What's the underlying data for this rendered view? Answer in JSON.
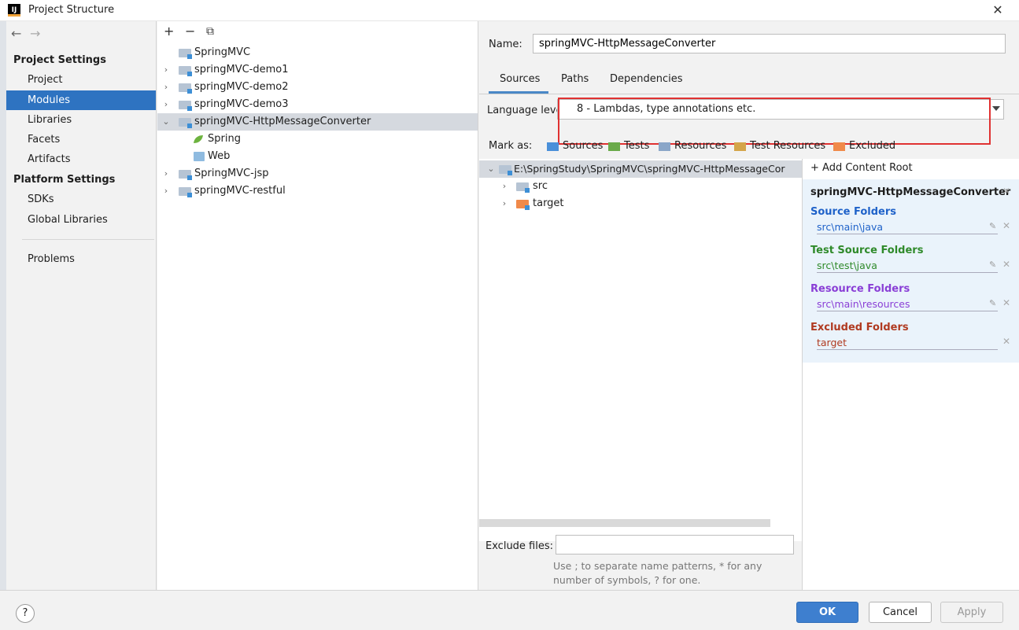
{
  "window": {
    "title": "Project Structure",
    "close": "✕"
  },
  "nav": {
    "back": "←",
    "forward": "→",
    "project_settings_header": "Project Settings",
    "project_items": [
      "Project",
      "Modules",
      "Libraries",
      "Facets",
      "Artifacts"
    ],
    "platform_settings_header": "Platform Settings",
    "platform_items": [
      "SDKs",
      "Global Libraries"
    ],
    "problems": "Problems",
    "selected": "Modules"
  },
  "module_tree": {
    "toolbar": {
      "add": "+",
      "remove": "−",
      "copy": "⧉"
    },
    "rows": [
      {
        "label": "SpringMVC",
        "chevron": ""
      },
      {
        "label": "springMVC-demo1",
        "chevron": "›"
      },
      {
        "label": "springMVC-demo2",
        "chevron": "›"
      },
      {
        "label": "springMVC-demo3",
        "chevron": "›"
      },
      {
        "label": "springMVC-HttpMessageConverter",
        "chevron": "⌄"
      },
      {
        "label": "Spring",
        "chevron": ""
      },
      {
        "label": "Web",
        "chevron": ""
      },
      {
        "label": "SpringMVC-jsp",
        "chevron": "›"
      },
      {
        "label": "springMVC-restful",
        "chevron": "›"
      }
    ]
  },
  "detail": {
    "name_label": "Name:",
    "name_value": "springMVC-HttpMessageConverter",
    "tabs": [
      "Sources",
      "Paths",
      "Dependencies"
    ],
    "active_tab": "Sources",
    "language_level_label": "Language level:",
    "language_level_value": "8 - Lambdas, type annotations etc.",
    "mark_as_label": "Mark as:",
    "mark_as": [
      {
        "label": "Sources",
        "color": "#4a90d9"
      },
      {
        "label": "Tests",
        "color": "#6aaa4a"
      },
      {
        "label": "Resources",
        "color": "#8aa6c8"
      },
      {
        "label": "Test Resources",
        "color": "#d4a54a"
      },
      {
        "label": "Excluded",
        "color": "#f08a4a"
      }
    ],
    "content_tree": [
      {
        "label": "E:\\SpringStudy\\SpringMVC\\springMVC-HttpMessageCor",
        "chevron": "⌄"
      },
      {
        "label": "src",
        "chevron": "›"
      },
      {
        "label": "target",
        "chevron": "›"
      }
    ],
    "exclude_files_label": "Exclude files:",
    "exclude_files_value": "",
    "exclude_help": "Use ; to separate name patterns, * for any number of symbols, ? for one.",
    "add_content_root": "+ Add Content Root",
    "content_root_name": "springMVC-HttpMessageConverter",
    "folder_groups": [
      {
        "title": "Source Folders",
        "path": "src\\main\\java",
        "color": "#1f62c9",
        "editable": true
      },
      {
        "title": "Test Source Folders",
        "path": "src\\test\\java",
        "color": "#2f8a2a",
        "editable": true
      },
      {
        "title": "Resource Folders",
        "path": "src\\main\\resources",
        "color": "#8a3fd6",
        "editable": true
      },
      {
        "title": "Excluded Folders",
        "path": "target",
        "color": "#b03a20",
        "editable": false
      }
    ]
  },
  "buttons": {
    "help": "?",
    "ok": "OK",
    "cancel": "Cancel",
    "apply": "Apply"
  }
}
